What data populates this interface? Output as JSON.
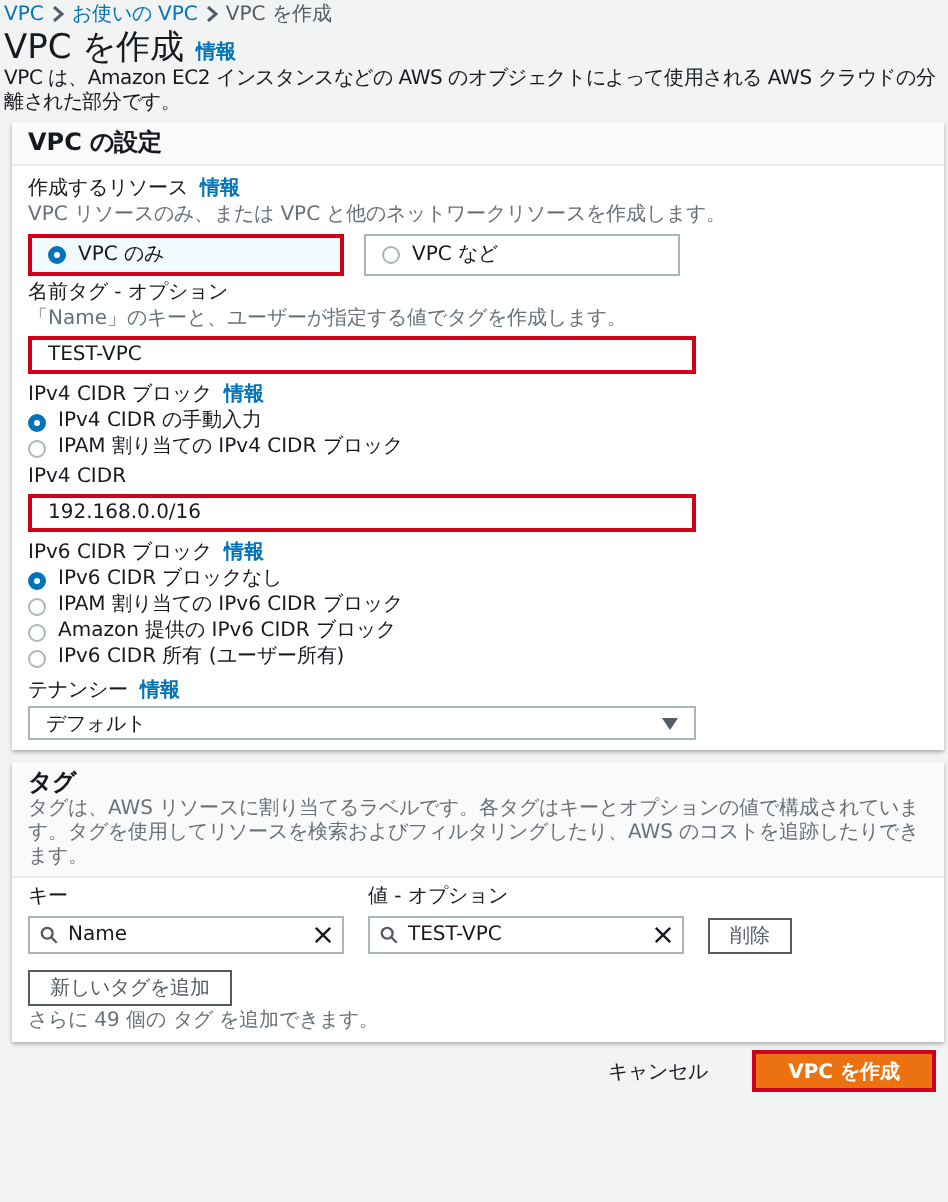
{
  "breadcrumb": [
    {
      "label": "VPC"
    },
    {
      "label": "お使いの VPC"
    },
    {
      "label": "VPC を作成"
    }
  ],
  "page": {
    "title": "VPC を作成",
    "info": "情報",
    "description": "VPC は、Amazon EC2 インスタンスなどの AWS のオブジェクトによって使用される AWS クラウドの分離された部分です。"
  },
  "settings": {
    "title": "VPC の設定",
    "resources": {
      "label": "作成するリソース",
      "info": "情報",
      "hint": "VPC リソースのみ、または VPC と他のネットワークリソースを作成します。",
      "options": [
        {
          "label": "VPC のみ",
          "selected": true,
          "highlighted": true
        },
        {
          "label": "VPC など",
          "selected": false,
          "highlighted": false
        }
      ]
    },
    "name_tag": {
      "label": "名前タグ - オプション",
      "hint": "「Name」のキーと、ユーザーが指定する値でタグを作成します。",
      "value": "TEST-VPC",
      "highlighted": true
    },
    "ipv4_block": {
      "label": "IPv4 CIDR ブロック",
      "info": "情報",
      "options": [
        {
          "label": "IPv4 CIDR の手動入力",
          "selected": true
        },
        {
          "label": "IPAM 割り当ての IPv4 CIDR ブロック",
          "selected": false
        }
      ]
    },
    "ipv4_cidr": {
      "label": "IPv4 CIDR",
      "value": "192.168.0.0/16",
      "highlighted": true
    },
    "ipv6_block": {
      "label": "IPv6 CIDR ブロック",
      "info": "情報",
      "options": [
        {
          "label": "IPv6 CIDR ブロックなし",
          "selected": true
        },
        {
          "label": "IPAM 割り当ての IPv6 CIDR ブロック",
          "selected": false
        },
        {
          "label": "Amazon 提供の IPv6 CIDR ブロック",
          "selected": false
        },
        {
          "label": "IPv6 CIDR 所有 (ユーザー所有)",
          "selected": false
        }
      ]
    },
    "tenancy": {
      "label": "テナンシー",
      "info": "情報",
      "value": "デフォルト"
    }
  },
  "tags": {
    "title": "タグ",
    "description": "タグは、AWS リソースに割り当てるラベルです。各タグはキーとオプションの値で構成されています。タグを使用してリソースを検索およびフィルタリングしたり、AWS のコストを追跡したりできます。",
    "key_label": "キー",
    "value_label": "値 - オプション",
    "rows": [
      {
        "key": "Name",
        "value": "TEST-VPC",
        "remove": "削除"
      }
    ],
    "add_button": "新しいタグを追加",
    "limit_note": "さらに 49 個の タグ を追加できます。"
  },
  "footer": {
    "cancel": "キャンセル",
    "submit": "VPC を作成",
    "submit_highlighted": true
  }
}
